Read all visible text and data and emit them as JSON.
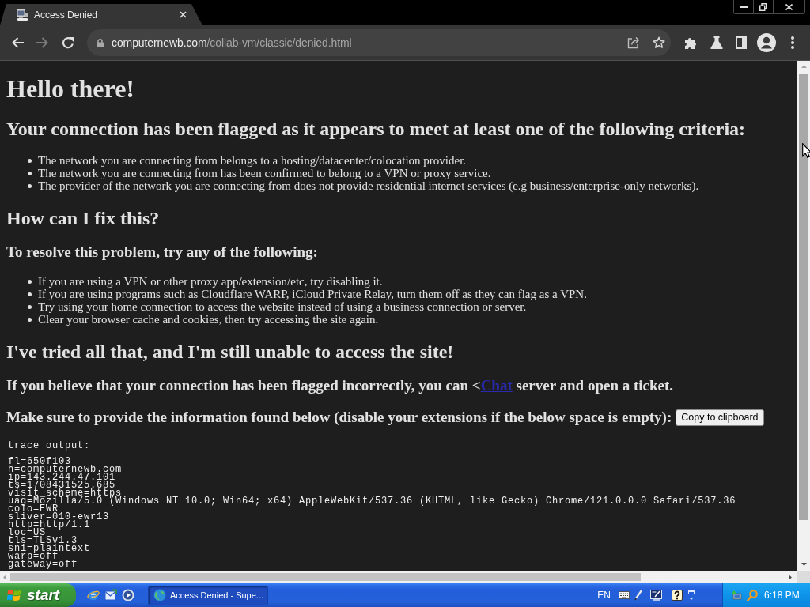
{
  "browser": {
    "tabs": [
      {
        "title": "Access Denied",
        "selected": true
      }
    ],
    "nav_buttons": [
      {
        "kind": "back",
        "disabled": false
      },
      {
        "kind": "forward",
        "disabled": true
      },
      {
        "kind": "reload",
        "disabled": false
      }
    ],
    "address": {
      "host": "computernewb.com",
      "path": "/collab-vm/classic/denied.html"
    }
  },
  "page": {
    "blocks": [
      {
        "kind": "h1",
        "text": "Hello there!"
      },
      {
        "kind": "h2",
        "text": "Your connection has been flagged as it appears to meet at least one of the following criteria:"
      },
      {
        "kind": "list",
        "items": [
          "The network you are connecting from belongs to a hosting/datacenter/colocation provider.",
          "The network you are connecting from has been confirmed to belong to a VPN or proxy service.",
          "The provider of the network you are connecting from does not provide residential internet services (e.g business/enterprise-only networks)."
        ]
      },
      {
        "kind": "h2",
        "text": "How can I fix this?"
      },
      {
        "kind": "h3",
        "text": "To resolve this problem, try any of the following:"
      },
      {
        "kind": "list",
        "items": [
          "If you are using a VPN or other proxy app/extension/etc, try disabling it.",
          "If you are using programs such as Cloudflare WARP, iCloud Private Relay, turn them off as they can flag as a VPN.",
          "Try using your home connection to access the website instead of using a business connection or server.",
          "Clear your browser cache and cookies, then try accessing the site again."
        ]
      },
      {
        "kind": "h2",
        "text": "I've tried all that, and I'm still unable to access the site!"
      },
      {
        "kind": "link_line",
        "before": "If you believe that your connection has been flagged incorrectly, you can <",
        "link": "Chat",
        "after": " server and open a ticket."
      },
      {
        "kind": "button_line",
        "text": "Make sure to provide the information found below (disable your extensions if the below space is empty):",
        "button": "Copy to clipboard"
      },
      {
        "kind": "trace",
        "label": "trace output:",
        "lines": [
          "fl=650f103",
          "h=computernewb.com",
          "ip=143.244.47.101",
          "ts=1708431525.685",
          "visit_scheme=https",
          "uag=Mozilla/5.0 (Windows NT 10.0; Win64; x64) AppleWebKit/537.36 (KHTML, like Gecko) Chrome/121.0.0.0 Safari/537.36",
          "colo=EWR",
          "sliver=010-ewr13",
          "http=http/1.1",
          "loc=US",
          "tls=TLSv1.3",
          "sni=plaintext",
          "warp=off",
          "gateway=off"
        ]
      }
    ]
  },
  "taskbar": {
    "start": "start",
    "tasks": [
      {
        "title": "Access Denied - Supe...",
        "selected": true
      }
    ],
    "language": "EN",
    "clock": "6:18 PM"
  }
}
